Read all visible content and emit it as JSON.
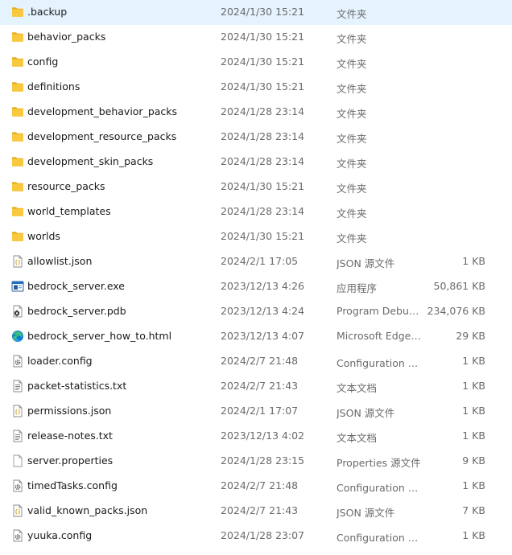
{
  "rows": [
    {
      "name": ".backup",
      "date": "2024/1/30 15:21",
      "type": "文件夹",
      "size": "",
      "icon": "folder-icon"
    },
    {
      "name": "behavior_packs",
      "date": "2024/1/30 15:21",
      "type": "文件夹",
      "size": "",
      "icon": "folder-icon"
    },
    {
      "name": "config",
      "date": "2024/1/30 15:21",
      "type": "文件夹",
      "size": "",
      "icon": "folder-icon"
    },
    {
      "name": "definitions",
      "date": "2024/1/30 15:21",
      "type": "文件夹",
      "size": "",
      "icon": "folder-icon"
    },
    {
      "name": "development_behavior_packs",
      "date": "2024/1/28 23:14",
      "type": "文件夹",
      "size": "",
      "icon": "folder-icon"
    },
    {
      "name": "development_resource_packs",
      "date": "2024/1/28 23:14",
      "type": "文件夹",
      "size": "",
      "icon": "folder-icon"
    },
    {
      "name": "development_skin_packs",
      "date": "2024/1/28 23:14",
      "type": "文件夹",
      "size": "",
      "icon": "folder-icon"
    },
    {
      "name": "resource_packs",
      "date": "2024/1/30 15:21",
      "type": "文件夹",
      "size": "",
      "icon": "folder-icon"
    },
    {
      "name": "world_templates",
      "date": "2024/1/28 23:14",
      "type": "文件夹",
      "size": "",
      "icon": "folder-icon"
    },
    {
      "name": "worlds",
      "date": "2024/1/30 15:21",
      "type": "文件夹",
      "size": "",
      "icon": "folder-icon"
    },
    {
      "name": "allowlist.json",
      "date": "2024/2/1 17:05",
      "type": "JSON 源文件",
      "size": "1 KB",
      "icon": "json-file-icon"
    },
    {
      "name": "bedrock_server.exe",
      "date": "2023/12/13 4:26",
      "type": "应用程序",
      "size": "50,861 KB",
      "icon": "exe-file-icon"
    },
    {
      "name": "bedrock_server.pdb",
      "date": "2023/12/13 4:24",
      "type": "Program Debug...",
      "size": "234,076 KB",
      "icon": "pdb-file-icon"
    },
    {
      "name": "bedrock_server_how_to.html",
      "date": "2023/12/13 4:07",
      "type": "Microsoft Edge ...",
      "size": "29 KB",
      "icon": "edge-html-icon"
    },
    {
      "name": "loader.config",
      "date": "2024/2/7 21:48",
      "type": "Configuration 源...",
      "size": "1 KB",
      "icon": "config-file-icon"
    },
    {
      "name": "packet-statistics.txt",
      "date": "2024/2/7 21:43",
      "type": "文本文档",
      "size": "1 KB",
      "icon": "text-file-icon"
    },
    {
      "name": "permissions.json",
      "date": "2024/2/1 17:07",
      "type": "JSON 源文件",
      "size": "1 KB",
      "icon": "json-file-icon"
    },
    {
      "name": "release-notes.txt",
      "date": "2023/12/13 4:02",
      "type": "文本文档",
      "size": "1 KB",
      "icon": "text-file-icon"
    },
    {
      "name": "server.properties",
      "date": "2024/1/28 23:15",
      "type": "Properties 源文件",
      "size": "9 KB",
      "icon": "properties-file-icon"
    },
    {
      "name": "timedTasks.config",
      "date": "2024/2/7 21:48",
      "type": "Configuration 源...",
      "size": "1 KB",
      "icon": "config-file-icon"
    },
    {
      "name": "valid_known_packs.json",
      "date": "2024/2/7 21:43",
      "type": "JSON 源文件",
      "size": "7 KB",
      "icon": "json-file-icon"
    },
    {
      "name": "yuuka.config",
      "date": "2024/1/28 23:07",
      "type": "Configuration 源...",
      "size": "1 KB",
      "icon": "config-file-icon"
    }
  ],
  "colors": {
    "folder": "#f8c93f",
    "folder_dark": "#e6ac1e",
    "text": "#1a1a1a",
    "muted": "#6a6a6a",
    "exe_blue": "#1f6fc4",
    "edge_blue": "#0c7cd5",
    "edge_green": "#3bc278"
  }
}
